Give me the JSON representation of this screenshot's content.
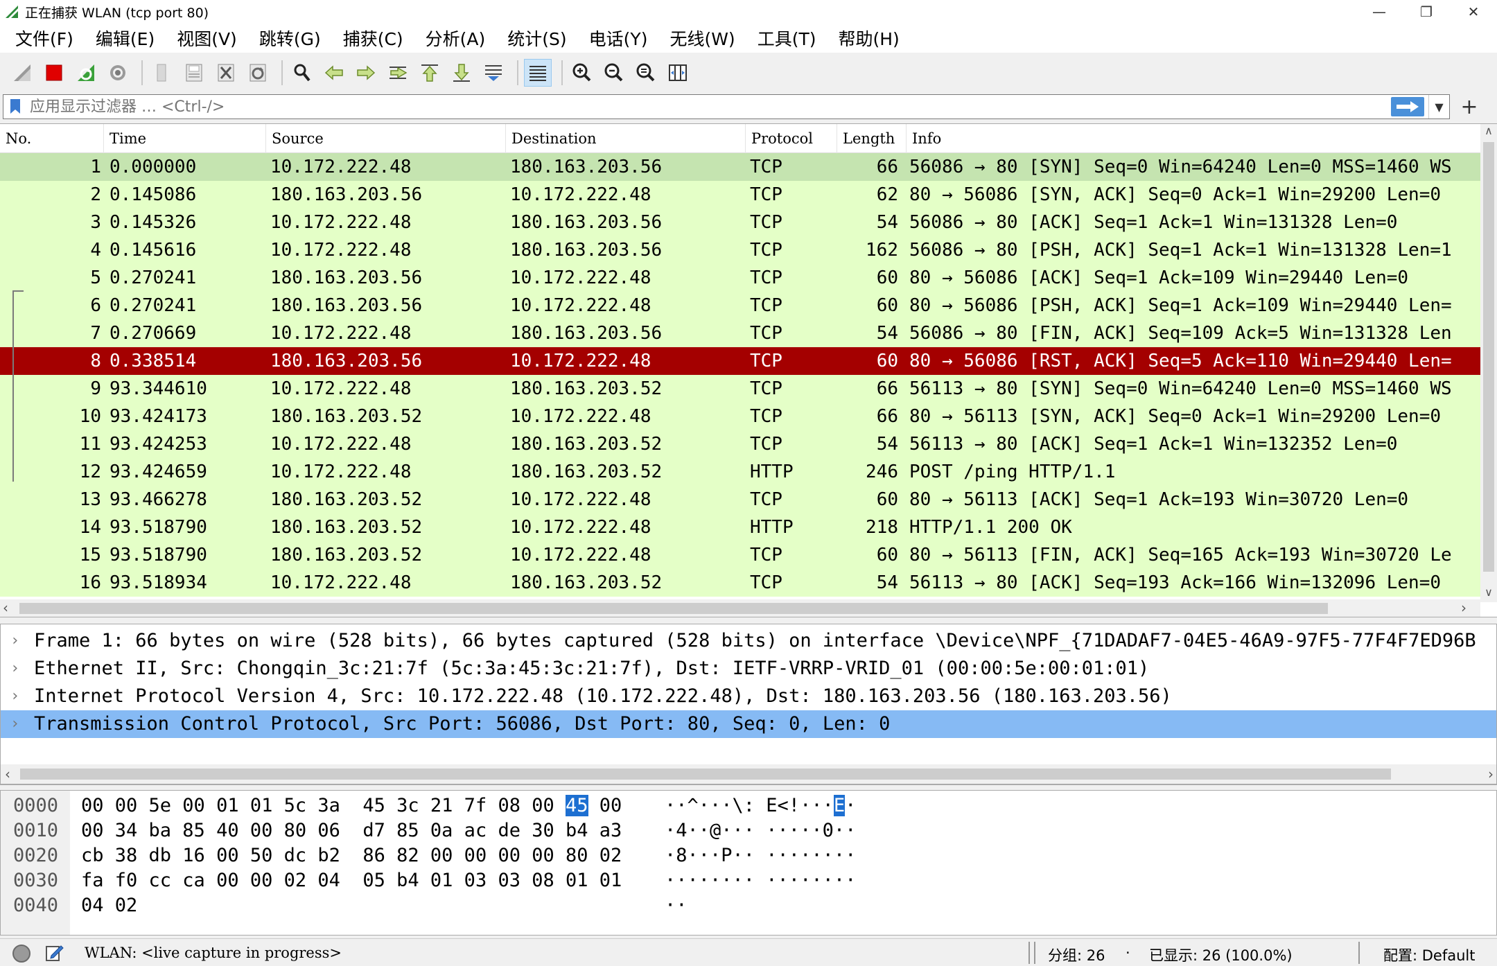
{
  "window": {
    "title": "正在捕获 WLAN (tcp port 80)",
    "minimize": "—",
    "restore": "❐",
    "close": "✕"
  },
  "menu": [
    "文件(F)",
    "编辑(E)",
    "视图(V)",
    "跳转(G)",
    "捕获(C)",
    "分析(A)",
    "统计(S)",
    "电话(Y)",
    "无线(W)",
    "工具(T)",
    "帮助(H)"
  ],
  "filter": {
    "placeholder": "应用显示过滤器 … <Ctrl-/>",
    "add": "+"
  },
  "columns": {
    "no": "No.",
    "time": "Time",
    "source": "Source",
    "destination": "Destination",
    "protocol": "Protocol",
    "length": "Length",
    "info": "Info"
  },
  "packets": [
    {
      "no": "1",
      "time": "0.000000",
      "src": "10.172.222.48",
      "dst": "180.163.203.56",
      "proto": "TCP",
      "len": "66",
      "info": "56086 → 80 [SYN] Seq=0 Win=64240 Len=0 MSS=1460 WS"
    },
    {
      "no": "2",
      "time": "0.145086",
      "src": "180.163.203.56",
      "dst": "10.172.222.48",
      "proto": "TCP",
      "len": "62",
      "info": "80 → 56086 [SYN, ACK] Seq=0 Ack=1 Win=29200 Len=0"
    },
    {
      "no": "3",
      "time": "0.145326",
      "src": "10.172.222.48",
      "dst": "180.163.203.56",
      "proto": "TCP",
      "len": "54",
      "info": "56086 → 80 [ACK] Seq=1 Ack=1 Win=131328 Len=0"
    },
    {
      "no": "4",
      "time": "0.145616",
      "src": "10.172.222.48",
      "dst": "180.163.203.56",
      "proto": "TCP",
      "len": "162",
      "info": "56086 → 80 [PSH, ACK] Seq=1 Ack=1 Win=131328 Len=1"
    },
    {
      "no": "5",
      "time": "0.270241",
      "src": "180.163.203.56",
      "dst": "10.172.222.48",
      "proto": "TCP",
      "len": "60",
      "info": "80 → 56086 [ACK] Seq=1 Ack=109 Win=29440 Len=0"
    },
    {
      "no": "6",
      "time": "0.270241",
      "src": "180.163.203.56",
      "dst": "10.172.222.48",
      "proto": "TCP",
      "len": "60",
      "info": "80 → 56086 [PSH, ACK] Seq=1 Ack=109 Win=29440 Len="
    },
    {
      "no": "7",
      "time": "0.270669",
      "src": "10.172.222.48",
      "dst": "180.163.203.56",
      "proto": "TCP",
      "len": "54",
      "info": "56086 → 80 [FIN, ACK] Seq=109 Ack=5 Win=131328 Len"
    },
    {
      "no": "8",
      "time": "0.338514",
      "src": "180.163.203.56",
      "dst": "10.172.222.48",
      "proto": "TCP",
      "len": "60",
      "info": "80 → 56086 [RST, ACK] Seq=5 Ack=110 Win=29440 Len="
    },
    {
      "no": "9",
      "time": "93.344610",
      "src": "10.172.222.48",
      "dst": "180.163.203.52",
      "proto": "TCP",
      "len": "66",
      "info": "56113 → 80 [SYN] Seq=0 Win=64240 Len=0 MSS=1460 WS"
    },
    {
      "no": "10",
      "time": "93.424173",
      "src": "180.163.203.52",
      "dst": "10.172.222.48",
      "proto": "TCP",
      "len": "66",
      "info": "80 → 56113 [SYN, ACK] Seq=0 Ack=1 Win=29200 Len=0"
    },
    {
      "no": "11",
      "time": "93.424253",
      "src": "10.172.222.48",
      "dst": "180.163.203.52",
      "proto": "TCP",
      "len": "54",
      "info": "56113 → 80 [ACK] Seq=1 Ack=1 Win=132352 Len=0"
    },
    {
      "no": "12",
      "time": "93.424659",
      "src": "10.172.222.48",
      "dst": "180.163.203.52",
      "proto": "HTTP",
      "len": "246",
      "info": "POST /ping HTTP/1.1"
    },
    {
      "no": "13",
      "time": "93.466278",
      "src": "180.163.203.52",
      "dst": "10.172.222.48",
      "proto": "TCP",
      "len": "60",
      "info": "80 → 56113 [ACK] Seq=1 Ack=193 Win=30720 Len=0"
    },
    {
      "no": "14",
      "time": "93.518790",
      "src": "180.163.203.52",
      "dst": "10.172.222.48",
      "proto": "HTTP",
      "len": "218",
      "info": "HTTP/1.1 200 OK"
    },
    {
      "no": "15",
      "time": "93.518790",
      "src": "180.163.203.52",
      "dst": "10.172.222.48",
      "proto": "TCP",
      "len": "60",
      "info": "80 → 56113 [FIN, ACK] Seq=165 Ack=193 Win=30720 Le"
    },
    {
      "no": "16",
      "time": "93.518934",
      "src": "10.172.222.48",
      "dst": "180.163.203.52",
      "proto": "TCP",
      "len": "54",
      "info": "56113 → 80 [ACK] Seq=193 Ack=166 Win=132096 Len=0"
    }
  ],
  "details": [
    {
      "text": "Frame 1: 66 bytes on wire (528 bits), 66 bytes captured (528 bits) on interface \\Device\\NPF_{71DADAF7-04E5-46A9-97F5-77F4F7ED96B"
    },
    {
      "text": "Ethernet II, Src: Chongqin_3c:21:7f (5c:3a:45:3c:21:7f), Dst: IETF-VRRP-VRID_01 (00:00:5e:00:01:01)"
    },
    {
      "text": "Internet Protocol Version 4, Src: 10.172.222.48 (10.172.222.48), Dst: 180.163.203.56 (180.163.203.56)"
    },
    {
      "text": "Transmission Control Protocol, Src Port: 56086, Dst Port: 80, Seq: 0, Len: 0"
    }
  ],
  "bytes": [
    {
      "off": "0000",
      "hex_a": "00 00 5e 00 01 01 5c 3a  45 3c 21 7f 08 00 ",
      "hex_hl": "45",
      "hex_b": " 00",
      "asc_a": "··^···\\: E<!···",
      "asc_hl": "E",
      "asc_b": "·"
    },
    {
      "off": "0010",
      "hex_a": "00 34 ba 85 40 00 80 06  d7 85 0a ac de 30 b4 a3",
      "hex_hl": "",
      "hex_b": "",
      "asc_a": "·4··@··· ·····0··",
      "asc_hl": "",
      "asc_b": ""
    },
    {
      "off": "0020",
      "hex_a": "cb 38 db 16 00 50 dc b2  86 82 00 00 00 00 80 02",
      "hex_hl": "",
      "hex_b": "",
      "asc_a": "·8···P·· ········",
      "asc_hl": "",
      "asc_b": ""
    },
    {
      "off": "0030",
      "hex_a": "fa f0 cc ca 00 00 02 04  05 b4 01 03 03 08 01 01",
      "hex_hl": "",
      "hex_b": "",
      "asc_a": "········ ········",
      "asc_hl": "",
      "asc_b": ""
    },
    {
      "off": "0040",
      "hex_a": "04 02",
      "hex_hl": "",
      "hex_b": "",
      "asc_a": "··",
      "asc_hl": "",
      "asc_b": ""
    }
  ],
  "status": {
    "capture": "WLAN: <live capture in progress>",
    "packets": "分组: 26",
    "bullet": "·",
    "displayed": "已显示: 26 (100.0%)",
    "profile": "配置: Default"
  },
  "colors": {
    "row_green": "#e4ffc7",
    "row_selected": "#c5e4b0",
    "row_rst": "#a40000",
    "detail_selected": "#86baf4",
    "byte_highlight": "#1d6fd1"
  }
}
